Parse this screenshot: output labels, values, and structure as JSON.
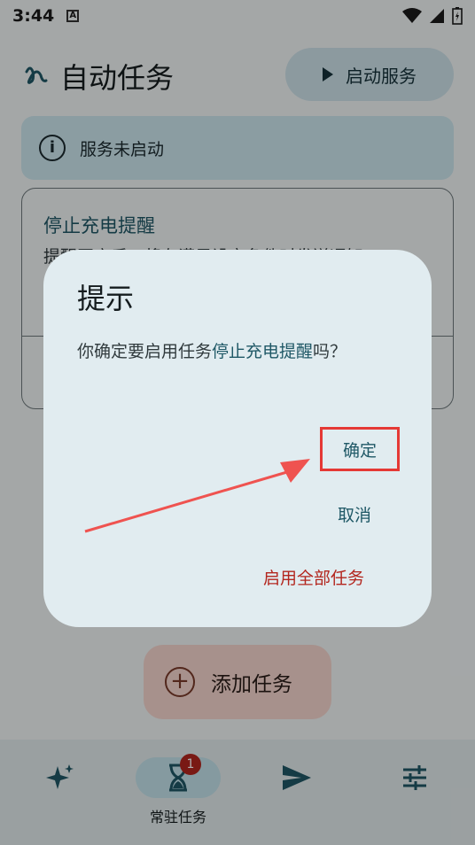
{
  "status_bar": {
    "time": "3:44",
    "notif_icon": "A"
  },
  "header": {
    "title": "自动任务",
    "start_button": "启动服务"
  },
  "notice": {
    "text": "服务未启动"
  },
  "task_card": {
    "title": "停止充电提醒",
    "description": "提醒开启后，将在满足设定条件时发送通知"
  },
  "fab": {
    "label": "添加任务"
  },
  "bottom_nav": {
    "items": [
      {
        "icon": "sparkle-icon"
      },
      {
        "icon": "hourglass-icon",
        "caption": "常驻任务",
        "badge": "1"
      },
      {
        "icon": "send-icon"
      },
      {
        "icon": "tune-icon"
      }
    ]
  },
  "dialog": {
    "title": "提示",
    "message_prefix": "你确定要启用任务",
    "message_task": "停止充电提醒",
    "message_suffix": "吗？",
    "confirm": "确定",
    "cancel": "取消",
    "enable_all": "启用全部任务"
  },
  "colors": {
    "accent": "#1f5866",
    "danger": "#b3261e",
    "highlight_box": "#e53935"
  }
}
